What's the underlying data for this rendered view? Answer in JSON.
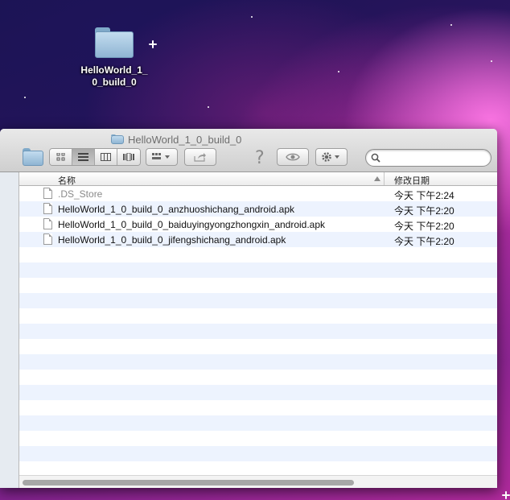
{
  "desktop": {
    "folder_label": "HelloWorld_1_\n0_build_0"
  },
  "window": {
    "title": "HelloWorld_1_0_build_0"
  },
  "toolbar": {
    "view_icons": "icon-view-icon",
    "view_list": "list-view-icon",
    "view_columns": "column-view-icon",
    "view_coverflow": "cover-flow-icon",
    "search_placeholder": ""
  },
  "list": {
    "headers": {
      "name": "名称",
      "date": "修改日期"
    },
    "files": [
      {
        "name": ".DS_Store",
        "date": "今天 下午2:24",
        "hidden": true
      },
      {
        "name": "HelloWorld_1_0_build_0_anzhuoshichang_android.apk",
        "date": "今天 下午2:20",
        "hidden": false
      },
      {
        "name": "HelloWorld_1_0_build_0_baiduyingyongzhongxin_android.apk",
        "date": "今天 下午2:20",
        "hidden": false
      },
      {
        "name": "HelloWorld_1_0_build_0_jifengshichang_android.apk",
        "date": "今天 下午2:20",
        "hidden": false
      }
    ]
  },
  "colors": {
    "row_stripe": "#edf3fe",
    "sidebar_bg": "#e6ebf1",
    "folder_blue": "#8fb5d3"
  }
}
